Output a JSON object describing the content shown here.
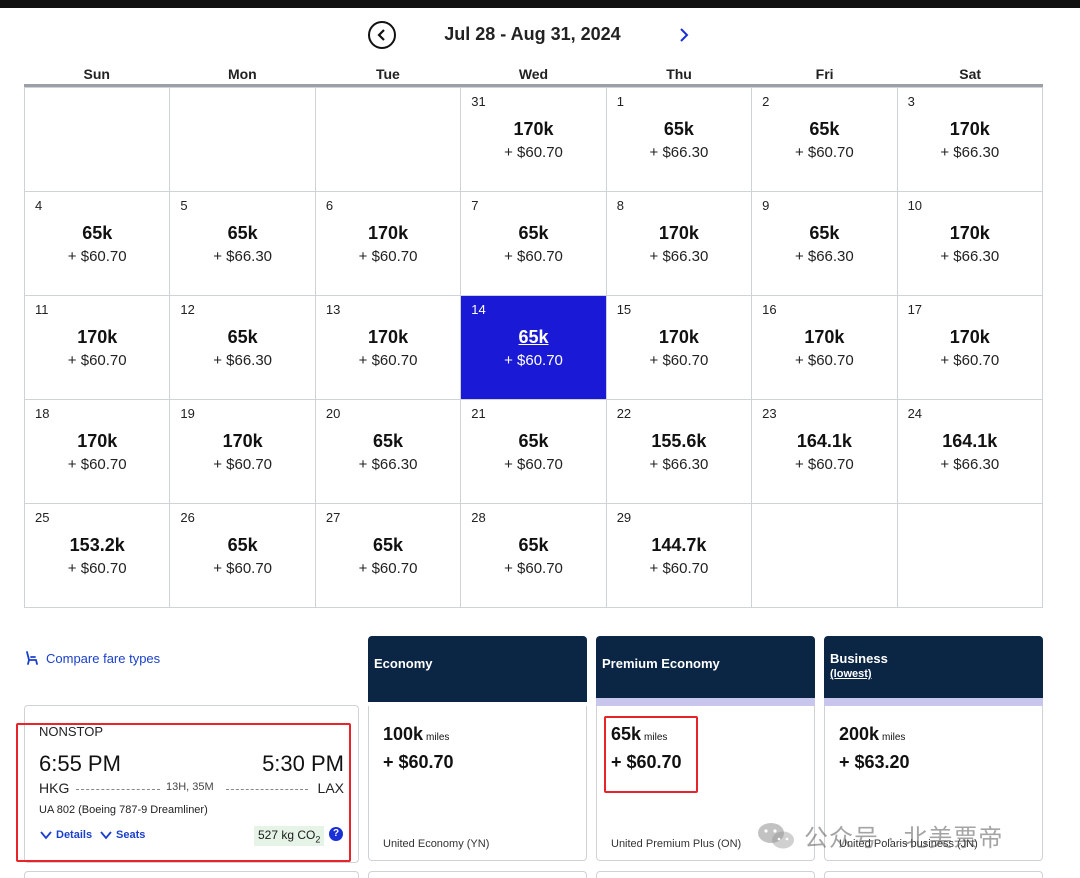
{
  "calendar": {
    "range_title": "Jul 28 - Aug 31, 2024",
    "weekdays": [
      "Sun",
      "Mon",
      "Tue",
      "Wed",
      "Thu",
      "Fri",
      "Sat"
    ],
    "days": [
      {
        "day": "",
        "miles": "",
        "tax": ""
      },
      {
        "day": "",
        "miles": "",
        "tax": ""
      },
      {
        "day": "",
        "miles": "",
        "tax": ""
      },
      {
        "day": "31",
        "miles": "170k",
        "tax": "+ $60.70"
      },
      {
        "day": "1",
        "miles": "65k",
        "tax": "+ $66.30"
      },
      {
        "day": "2",
        "miles": "65k",
        "tax": "+ $60.70"
      },
      {
        "day": "3",
        "miles": "170k",
        "tax": "+ $66.30"
      },
      {
        "day": "4",
        "miles": "65k",
        "tax": "+ $60.70"
      },
      {
        "day": "5",
        "miles": "65k",
        "tax": "+ $66.30"
      },
      {
        "day": "6",
        "miles": "170k",
        "tax": "+ $60.70"
      },
      {
        "day": "7",
        "miles": "65k",
        "tax": "+ $60.70"
      },
      {
        "day": "8",
        "miles": "170k",
        "tax": "+ $66.30"
      },
      {
        "day": "9",
        "miles": "65k",
        "tax": "+ $66.30"
      },
      {
        "day": "10",
        "miles": "170k",
        "tax": "+ $66.30"
      },
      {
        "day": "11",
        "miles": "170k",
        "tax": "+ $60.70"
      },
      {
        "day": "12",
        "miles": "65k",
        "tax": "+ $66.30"
      },
      {
        "day": "13",
        "miles": "170k",
        "tax": "+ $60.70"
      },
      {
        "day": "14",
        "miles": "65k",
        "tax": "+ $60.70",
        "selected": true
      },
      {
        "day": "15",
        "miles": "170k",
        "tax": "+ $60.70"
      },
      {
        "day": "16",
        "miles": "170k",
        "tax": "+ $60.70"
      },
      {
        "day": "17",
        "miles": "170k",
        "tax": "+ $60.70"
      },
      {
        "day": "18",
        "miles": "170k",
        "tax": "+ $60.70"
      },
      {
        "day": "19",
        "miles": "170k",
        "tax": "+ $60.70"
      },
      {
        "day": "20",
        "miles": "65k",
        "tax": "+ $66.30"
      },
      {
        "day": "21",
        "miles": "65k",
        "tax": "+ $60.70"
      },
      {
        "day": "22",
        "miles": "155.6k",
        "tax": "+ $66.30"
      },
      {
        "day": "23",
        "miles": "164.1k",
        "tax": "+ $60.70"
      },
      {
        "day": "24",
        "miles": "164.1k",
        "tax": "+ $66.30"
      },
      {
        "day": "25",
        "miles": "153.2k",
        "tax": "+ $60.70"
      },
      {
        "day": "26",
        "miles": "65k",
        "tax": "+ $60.70"
      },
      {
        "day": "27",
        "miles": "65k",
        "tax": "+ $60.70"
      },
      {
        "day": "28",
        "miles": "65k",
        "tax": "+ $60.70"
      },
      {
        "day": "29",
        "miles": "144.7k",
        "tax": "+ $60.70"
      },
      {
        "day": "",
        "miles": "",
        "tax": ""
      },
      {
        "day": "",
        "miles": "",
        "tax": ""
      }
    ]
  },
  "compare": {
    "label": "Compare fare types"
  },
  "flight": {
    "stops": "NONSTOP",
    "depart_time": "6:55 PM",
    "arrive_time": "5:30 PM",
    "origin": "HKG",
    "destination": "LAX",
    "duration": "13H, 35M",
    "flight_number": "UA 802 (Boeing 787-9 Dreamliner)",
    "details_label": "Details",
    "seats_label": "Seats",
    "co2_value": "527 kg CO",
    "co2_sub": "2",
    "info_label": "?"
  },
  "fares": [
    {
      "name": "Economy",
      "sub": "",
      "miles": "100k",
      "miles_unit": "miles",
      "tax": "+ $60.70",
      "code": "United Economy (YN)"
    },
    {
      "name": "Premium Economy",
      "sub": "",
      "miles": "65k",
      "miles_unit": "miles",
      "tax": "+ $60.70",
      "code": "United Premium Plus (ON)"
    },
    {
      "name": "Business",
      "sub": "(lowest)",
      "miles": "200k",
      "miles_unit": "miles",
      "tax": "+ $63.20",
      "code": "United Polaris business (JN)"
    }
  ],
  "watermark": {
    "text": "公众号 · 北美票帝"
  },
  "colors": {
    "selected_day": "#1a1ad6",
    "fare_header": "#0b2545",
    "highlight_box": "#e8232a",
    "link": "#1a3fcc"
  }
}
